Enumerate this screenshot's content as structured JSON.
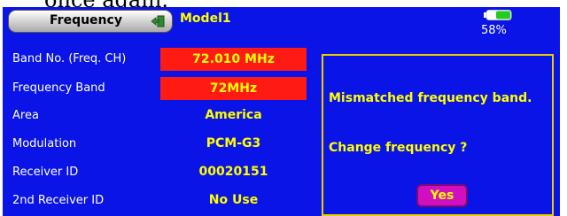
{
  "caption": "once again.",
  "header": {
    "title": "Frequency",
    "model": "Model1",
    "battery_percent_label": "58%",
    "battery_level": 0.58,
    "exit_icon": "exit-door-icon"
  },
  "rows": [
    {
      "label": "Band No. (Freq. CH)",
      "value": "72.010 MHz"
    },
    {
      "label": "Frequency Band",
      "value": "72MHz"
    },
    {
      "label": "Area",
      "value": "America"
    },
    {
      "label": "Modulation",
      "value": "PCM-G3"
    },
    {
      "label": "Receiver ID",
      "value": "00020151"
    },
    {
      "label": "2nd Receiver ID",
      "value": "No Use"
    }
  ],
  "dialog": {
    "message": "Mismatched frequency band.",
    "prompt": "Change frequency ?",
    "yes_label": "Yes"
  },
  "colors": {
    "screen_bg": "#0a14e6",
    "value_text": "#ffff00",
    "alert_bg": "#ff1a14",
    "button_bg": "#d010c0"
  }
}
